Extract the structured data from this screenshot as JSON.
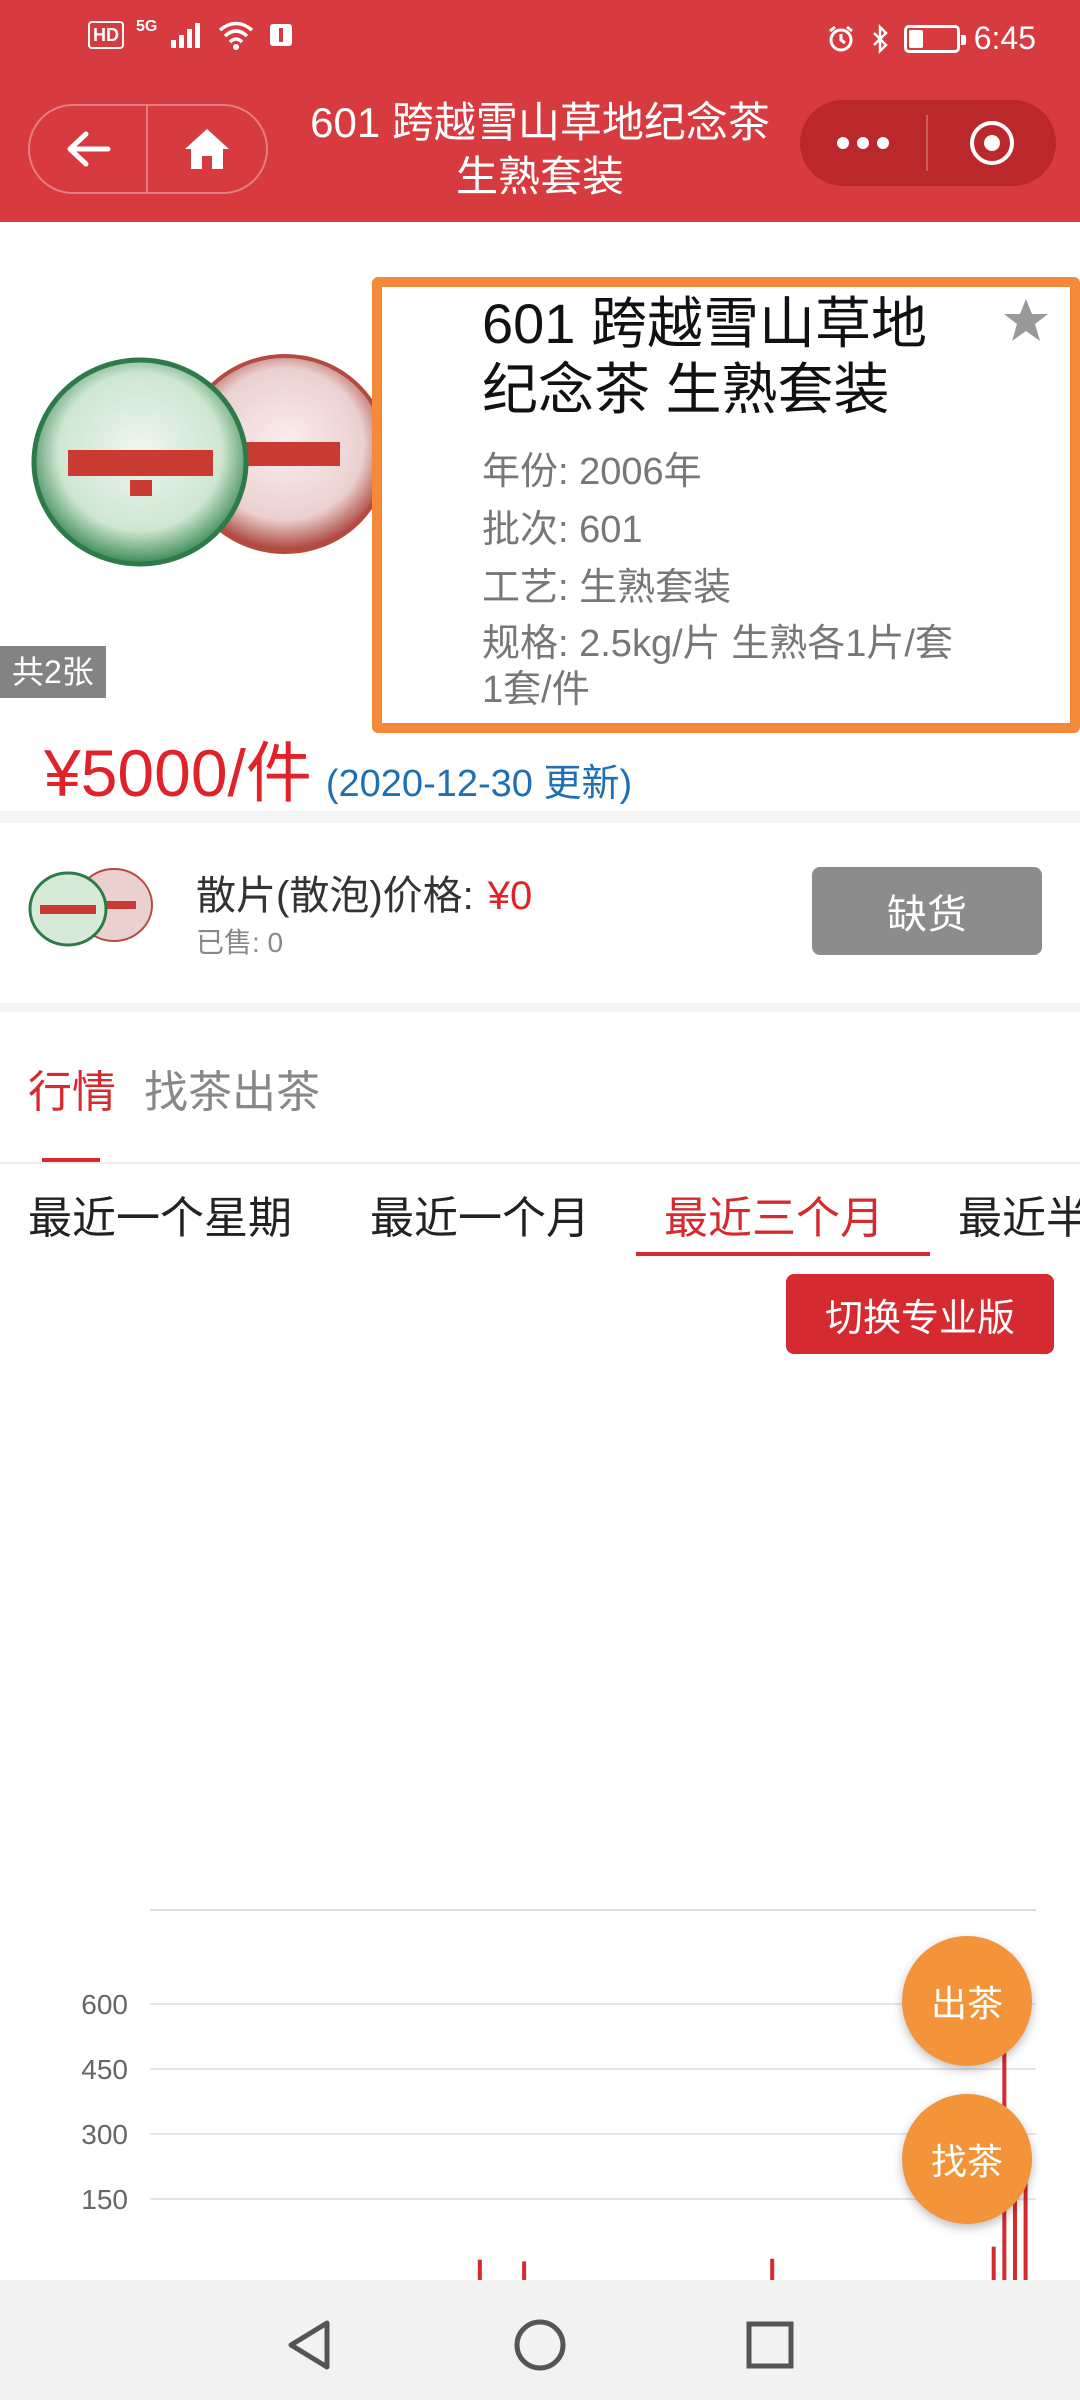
{
  "status_bar": {
    "hd_badge": "HD",
    "network": "5G",
    "time": "6:45",
    "battery_level": 0.3,
    "icons": [
      "signal-icon",
      "wifi-icon",
      "book-icon",
      "alarm-icon",
      "bluetooth-icon",
      "battery-icon"
    ]
  },
  "nav": {
    "title_line1": "601 跨越雪山草地纪念茶",
    "title_line2": "生熟套装",
    "back_icon": "arrow-left-icon",
    "home_icon": "home-icon",
    "more_icon": "more-dots-icon",
    "close_icon": "target-icon"
  },
  "product": {
    "image_count": "共2张",
    "title": "601 跨越雪山草地纪念茶 生熟套装",
    "year": "年份: 2006年",
    "batch": "批次: 601",
    "craft": "工艺: 生熟套装",
    "spec_line1": "规格: 2.5kg/片 生熟各1片/套",
    "spec_line2": "1套/件",
    "price": "¥5000/件",
    "update": "(2020-12-30 更新)",
    "favorite_icon": "star-icon",
    "colors": {
      "accent": "#d73a3f",
      "price": "#e0232a",
      "highlight": "#f5893a"
    }
  },
  "loose": {
    "label": "散片(散泡)价格:",
    "price": "¥0",
    "sold": "已售: 0",
    "button": "缺货"
  },
  "tabs": [
    {
      "label": "行情",
      "active": true
    },
    {
      "label": "找茶出茶",
      "active": false
    }
  ],
  "periods": [
    {
      "label": "最近一个星期",
      "active": false
    },
    {
      "label": "最近一个月",
      "active": false
    },
    {
      "label": "最近三个月",
      "active": true
    },
    {
      "label": "最近半",
      "active": false
    }
  ],
  "pro_button": "切换专业版",
  "chart_data": {
    "type": "bar",
    "yticks": [
      150,
      300,
      450,
      600
    ],
    "ylim": [
      0,
      750
    ],
    "grid": true,
    "title": "",
    "xlabel": "",
    "ylabel": "",
    "bars": [
      {
        "x": 0.37,
        "value": 10
      },
      {
        "x": 0.42,
        "value": 6
      },
      {
        "x": 0.7,
        "value": 12
      },
      {
        "x": 0.95,
        "value": 40
      },
      {
        "x": 0.962,
        "value": 490
      },
      {
        "x": 0.974,
        "value": 330
      },
      {
        "x": 0.986,
        "value": 200
      }
    ]
  },
  "fabs": {
    "sell": "出茶",
    "find": "找茶"
  },
  "system_nav": {
    "back": "back-triangle-icon",
    "home": "home-circle-icon",
    "recents": "recents-square-icon"
  }
}
